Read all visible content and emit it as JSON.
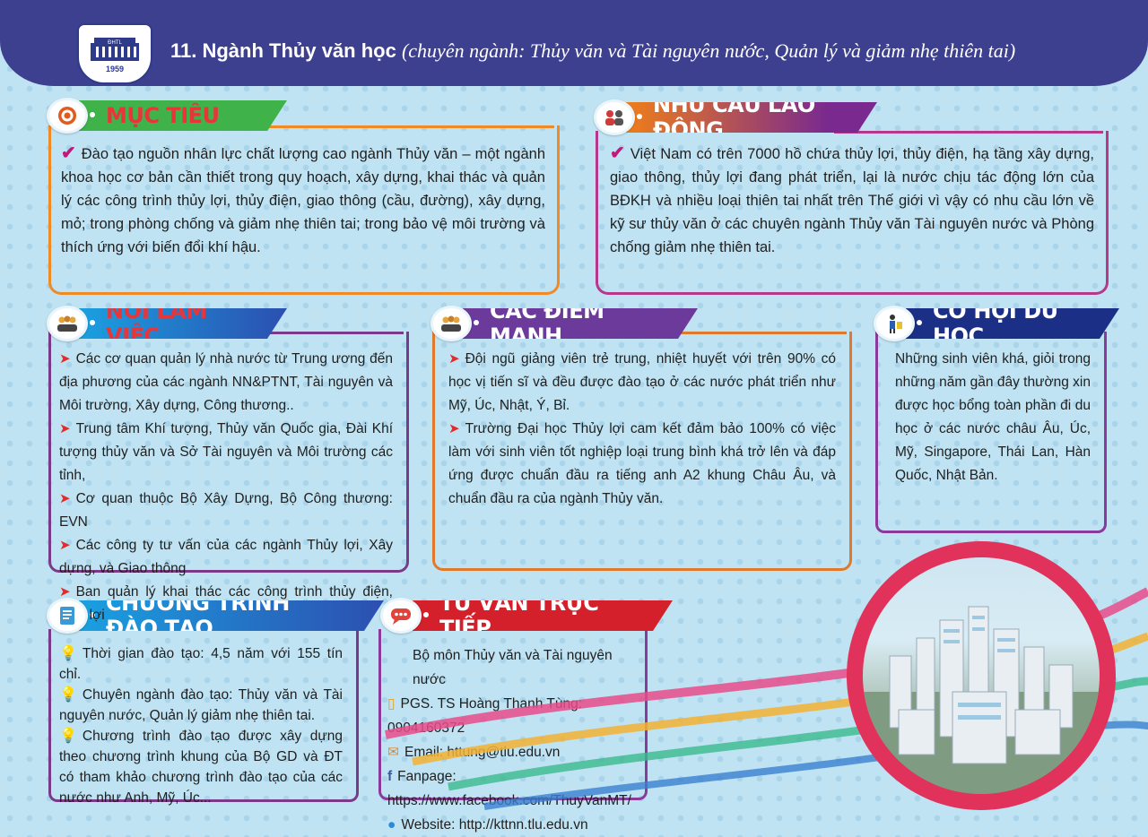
{
  "header": {
    "logo_text": "ĐHTL",
    "logo_year": "1959",
    "title": "11. Ngành Thủy văn  học",
    "subtitle": "(chuyên ngành: Thủy văn và Tài nguyên nước, Quản lý và giảm nhẹ thiên tai)"
  },
  "sections": {
    "muc_tieu": {
      "label": "MỤC TIÊU",
      "text": "Đào tạo nguồn nhân lực chất lượng cao ngành Thủy văn – một ngành khoa học cơ bản cần thiết trong quy hoạch, xây dựng, khai thác và quản lý các công trình thủy lợi, thủy điện, giao thông (cầu, đường), xây dựng, mỏ; trong phòng chống và giảm nhẹ thiên tai; trong bảo vệ môi trường và thích ứng với biến đổi khí hậu."
    },
    "nhu_cau": {
      "label": "NHU CẦU LAO ĐỘNG",
      "text": "Việt Nam có trên 7000 hồ chứa thủy lợi, thủy điện, hạ tầng xây dựng, giao thông, thủy lợi đang phát triển, lại là nước chịu tác động lớn của BĐKH và nhiều loại thiên tai nhất trên Thế giới vì vậy có nhu cầu lớn về kỹ sư thủy văn ở các chuyên ngành Thủy văn Tài nguyên nước và Phòng chống giảm nhẹ thiên tai."
    },
    "noi_lam_viec": {
      "label": "NƠI LÀM VIỆC",
      "items": [
        "Các cơ quan quản lý nhà nước từ Trung ương đến địa phương của các ngành NN&PTNT, Tài nguyên và Môi trường, Xây dựng, Công thương..",
        "Trung tâm Khí tượng, Thủy văn Quốc gia, Đài Khí tượng thủy văn và Sở Tài nguyên và Môi trường các tỉnh,",
        "Cơ quan thuộc Bộ Xây Dựng, Bộ Công thương: EVN",
        "Các công ty tư vấn của các ngành Thủy lợi, Xây dựng, và Giao thông",
        "Ban quản lý khai thác các công trình thủy điện, thủy lợi"
      ]
    },
    "diem_manh": {
      "label": "CÁC ĐIỂM MẠNH",
      "items": [
        "Đội ngũ giảng viên trẻ trung, nhiệt huyết với trên 90% có học vị tiến sĩ và đều được đào tạo ở các nước phát triển như Mỹ, Úc, Nhật, Ý, Bỉ.",
        "Trường Đại học Thủy lợi cam kết đảm bảo 100% có việc làm với sinh viên tốt nghiệp loại trung bình khá trở lên và đáp ứng được chuẩn đầu ra tiếng anh A2 khung Châu Âu, và chuẩn đầu ra của ngành Thủy văn."
      ]
    },
    "du_hoc": {
      "label": "CƠ HỘI DU HỌC",
      "text": "Những sinh viên khá, giỏi trong những năm gần đây thường xin được học bổng toàn phần đi du học ở các nước châu Âu, Úc, Mỹ, Singapore, Thái Lan, Hàn Quốc, Nhật Bản."
    },
    "chuong_trinh": {
      "label": "CHƯƠNG TRÌNH ĐÀO TẠO",
      "items": [
        "Thời gian đào tạo: 4,5 năm với 155 tín chỉ.",
        "Chuyên ngành đào tạo: Thủy văn và Tài nguyên nước, Quản lý giảm nhẹ thiên tai.",
        "Chương trình đào tạo được xây dựng theo chương trình khung của Bộ GD và ĐT có tham khảo chương trình đào tạo của các nước như Anh, Mỹ, Úc..."
      ]
    },
    "tu_van": {
      "label": "TƯ VẤN TRỰC TIẾP",
      "department": "Bộ môn Thủy văn và Tài nguyên nước",
      "contacts": [
        {
          "icon": "phone-icon",
          "text": "PGS. TS Hoàng Thanh Tùng: 0904160372"
        },
        {
          "icon": "email-icon",
          "text": "Email: httung@tlu.edu.vn"
        },
        {
          "icon": "facebook-icon",
          "text": "Fanpage: https://www.facebook.com/ThuyVanMT/"
        },
        {
          "icon": "globe-icon",
          "text": "Website: http://kttnn.tlu.edu.vn"
        }
      ]
    }
  },
  "colors": {
    "header": "#3d3f8f",
    "muc_tieu": "#3fb24a",
    "nhu_cau": "#5a2f8f",
    "noi_lam_viec": "#1e7fd0",
    "diem_manh": "#6b3a9a",
    "du_hoc": "#1c2f86",
    "chuong_trinh": "#1e8fd8",
    "tu_van": "#d4202a"
  }
}
